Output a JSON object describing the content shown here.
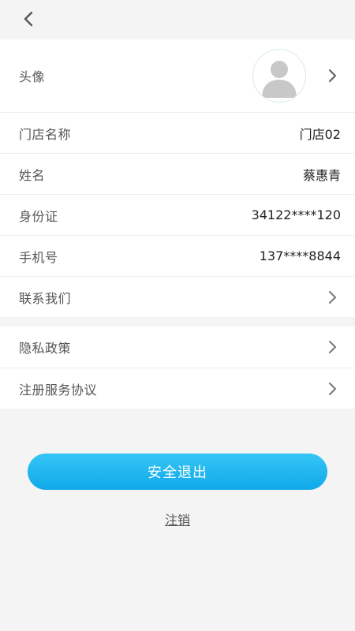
{
  "header": {
    "back_icon": "chevron-left-icon"
  },
  "profile": {
    "avatar_label": "头像",
    "store_label": "门店名称",
    "store_value": "门店02",
    "name_label": "姓名",
    "name_value": "蔡惠青",
    "id_label": "身份证",
    "id_value": "34122****120",
    "phone_label": "手机号",
    "phone_value": "137****8844",
    "contact_label": "联系我们"
  },
  "legal": {
    "privacy_label": "隐私政策",
    "agreement_label": "注册服务协议"
  },
  "actions": {
    "logout_label": "安全退出",
    "cancel_account_label": "注销"
  },
  "colors": {
    "accent": "#1AAEEE",
    "background": "#F4F4F4",
    "card": "#FFFFFF"
  }
}
